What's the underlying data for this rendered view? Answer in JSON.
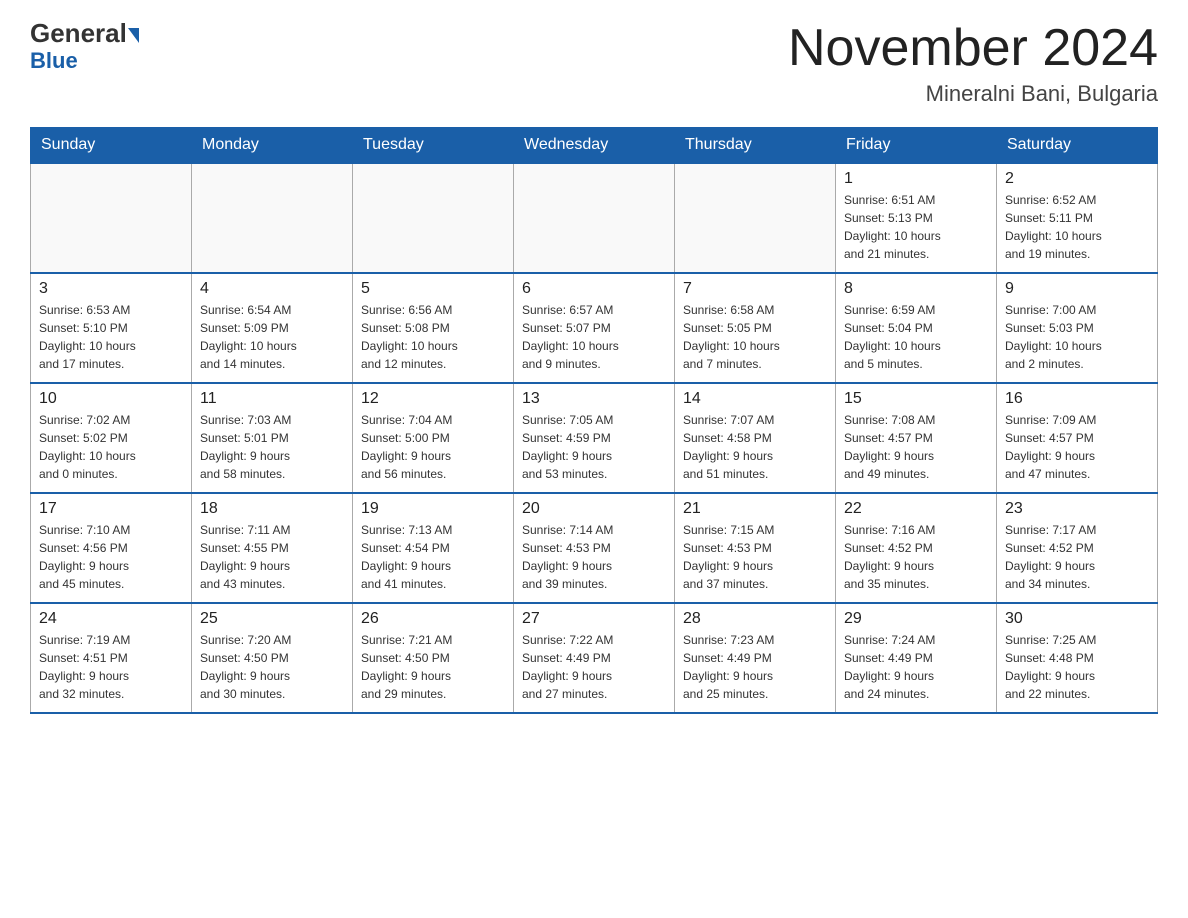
{
  "header": {
    "logo_general": "General",
    "logo_blue": "Blue",
    "month_title": "November 2024",
    "location": "Mineralni Bani, Bulgaria"
  },
  "days_of_week": [
    "Sunday",
    "Monday",
    "Tuesday",
    "Wednesday",
    "Thursday",
    "Friday",
    "Saturday"
  ],
  "weeks": [
    [
      {
        "day": "",
        "info": ""
      },
      {
        "day": "",
        "info": ""
      },
      {
        "day": "",
        "info": ""
      },
      {
        "day": "",
        "info": ""
      },
      {
        "day": "",
        "info": ""
      },
      {
        "day": "1",
        "info": "Sunrise: 6:51 AM\nSunset: 5:13 PM\nDaylight: 10 hours\nand 21 minutes."
      },
      {
        "day": "2",
        "info": "Sunrise: 6:52 AM\nSunset: 5:11 PM\nDaylight: 10 hours\nand 19 minutes."
      }
    ],
    [
      {
        "day": "3",
        "info": "Sunrise: 6:53 AM\nSunset: 5:10 PM\nDaylight: 10 hours\nand 17 minutes."
      },
      {
        "day": "4",
        "info": "Sunrise: 6:54 AM\nSunset: 5:09 PM\nDaylight: 10 hours\nand 14 minutes."
      },
      {
        "day": "5",
        "info": "Sunrise: 6:56 AM\nSunset: 5:08 PM\nDaylight: 10 hours\nand 12 minutes."
      },
      {
        "day": "6",
        "info": "Sunrise: 6:57 AM\nSunset: 5:07 PM\nDaylight: 10 hours\nand 9 minutes."
      },
      {
        "day": "7",
        "info": "Sunrise: 6:58 AM\nSunset: 5:05 PM\nDaylight: 10 hours\nand 7 minutes."
      },
      {
        "day": "8",
        "info": "Sunrise: 6:59 AM\nSunset: 5:04 PM\nDaylight: 10 hours\nand 5 minutes."
      },
      {
        "day": "9",
        "info": "Sunrise: 7:00 AM\nSunset: 5:03 PM\nDaylight: 10 hours\nand 2 minutes."
      }
    ],
    [
      {
        "day": "10",
        "info": "Sunrise: 7:02 AM\nSunset: 5:02 PM\nDaylight: 10 hours\nand 0 minutes."
      },
      {
        "day": "11",
        "info": "Sunrise: 7:03 AM\nSunset: 5:01 PM\nDaylight: 9 hours\nand 58 minutes."
      },
      {
        "day": "12",
        "info": "Sunrise: 7:04 AM\nSunset: 5:00 PM\nDaylight: 9 hours\nand 56 minutes."
      },
      {
        "day": "13",
        "info": "Sunrise: 7:05 AM\nSunset: 4:59 PM\nDaylight: 9 hours\nand 53 minutes."
      },
      {
        "day": "14",
        "info": "Sunrise: 7:07 AM\nSunset: 4:58 PM\nDaylight: 9 hours\nand 51 minutes."
      },
      {
        "day": "15",
        "info": "Sunrise: 7:08 AM\nSunset: 4:57 PM\nDaylight: 9 hours\nand 49 minutes."
      },
      {
        "day": "16",
        "info": "Sunrise: 7:09 AM\nSunset: 4:57 PM\nDaylight: 9 hours\nand 47 minutes."
      }
    ],
    [
      {
        "day": "17",
        "info": "Sunrise: 7:10 AM\nSunset: 4:56 PM\nDaylight: 9 hours\nand 45 minutes."
      },
      {
        "day": "18",
        "info": "Sunrise: 7:11 AM\nSunset: 4:55 PM\nDaylight: 9 hours\nand 43 minutes."
      },
      {
        "day": "19",
        "info": "Sunrise: 7:13 AM\nSunset: 4:54 PM\nDaylight: 9 hours\nand 41 minutes."
      },
      {
        "day": "20",
        "info": "Sunrise: 7:14 AM\nSunset: 4:53 PM\nDaylight: 9 hours\nand 39 minutes."
      },
      {
        "day": "21",
        "info": "Sunrise: 7:15 AM\nSunset: 4:53 PM\nDaylight: 9 hours\nand 37 minutes."
      },
      {
        "day": "22",
        "info": "Sunrise: 7:16 AM\nSunset: 4:52 PM\nDaylight: 9 hours\nand 35 minutes."
      },
      {
        "day": "23",
        "info": "Sunrise: 7:17 AM\nSunset: 4:52 PM\nDaylight: 9 hours\nand 34 minutes."
      }
    ],
    [
      {
        "day": "24",
        "info": "Sunrise: 7:19 AM\nSunset: 4:51 PM\nDaylight: 9 hours\nand 32 minutes."
      },
      {
        "day": "25",
        "info": "Sunrise: 7:20 AM\nSunset: 4:50 PM\nDaylight: 9 hours\nand 30 minutes."
      },
      {
        "day": "26",
        "info": "Sunrise: 7:21 AM\nSunset: 4:50 PM\nDaylight: 9 hours\nand 29 minutes."
      },
      {
        "day": "27",
        "info": "Sunrise: 7:22 AM\nSunset: 4:49 PM\nDaylight: 9 hours\nand 27 minutes."
      },
      {
        "day": "28",
        "info": "Sunrise: 7:23 AM\nSunset: 4:49 PM\nDaylight: 9 hours\nand 25 minutes."
      },
      {
        "day": "29",
        "info": "Sunrise: 7:24 AM\nSunset: 4:49 PM\nDaylight: 9 hours\nand 24 minutes."
      },
      {
        "day": "30",
        "info": "Sunrise: 7:25 AM\nSunset: 4:48 PM\nDaylight: 9 hours\nand 22 minutes."
      }
    ]
  ]
}
